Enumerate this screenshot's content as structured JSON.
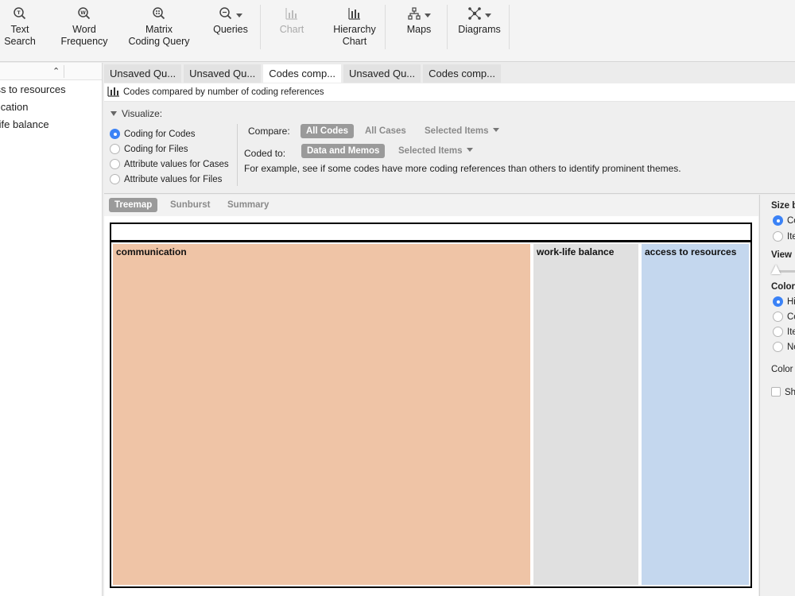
{
  "toolbar": {
    "items": [
      {
        "label": "Text\nSearch",
        "icon": "text-search-icon",
        "enabled": true
      },
      {
        "label": "Word\nFrequency",
        "icon": "word-frequency-icon",
        "enabled": true
      },
      {
        "label": "Matrix\nCoding Query",
        "icon": "matrix-coding-icon",
        "enabled": true
      },
      {
        "label": "Queries",
        "icon": "queries-icon",
        "enabled": true
      },
      {
        "label": "Chart",
        "icon": "chart-icon",
        "enabled": false
      },
      {
        "label": "Hierarchy\nChart",
        "icon": "hierarchy-chart-icon",
        "enabled": true
      },
      {
        "label": "Maps",
        "icon": "maps-icon",
        "enabled": true
      },
      {
        "label": "Diagrams",
        "icon": "diagrams-icon",
        "enabled": true
      }
    ]
  },
  "left_panel": {
    "items": [
      "access to resources",
      "communication",
      "work-life balance"
    ]
  },
  "tabs": [
    {
      "label": "Unsaved Qu...",
      "active": false
    },
    {
      "label": "Unsaved Qu...",
      "active": false
    },
    {
      "label": "Codes comp...",
      "active": true
    },
    {
      "label": "Unsaved Qu...",
      "active": false
    },
    {
      "label": "Codes comp...",
      "active": false
    }
  ],
  "query": {
    "title": "Codes compared by number of coding references"
  },
  "visualize": {
    "title": "Visualize:",
    "options": [
      {
        "label": "Coding for Codes",
        "selected": true
      },
      {
        "label": "Coding for Files",
        "selected": false
      },
      {
        "label": "Attribute values for Cases",
        "selected": false
      },
      {
        "label": "Attribute values for Files",
        "selected": false
      }
    ],
    "compare_label": "Compare:",
    "compare_selected": "All Codes",
    "compare_other": "All Cases",
    "compare_dropdown": "Selected Items",
    "coded_to_label": "Coded to:",
    "coded_to_selected": "Data and Memos",
    "coded_to_dropdown": "Selected Items",
    "example": "For example, see if some codes have more coding references than others to identify prominent themes."
  },
  "view_tabs": [
    {
      "label": "Treemap",
      "active": true
    },
    {
      "label": "Sunburst",
      "active": false
    },
    {
      "label": "Summary",
      "active": false
    }
  ],
  "treemap": {
    "cells": [
      {
        "label": "communication",
        "color": "#efc4a6",
        "share": 0.6635
      },
      {
        "label": "work-life balance",
        "color": "#e0e0e0",
        "share": 0.1665
      },
      {
        "label": "access to resources",
        "color": "#c4d7ee",
        "share": 0.17
      }
    ]
  },
  "right_panel": {
    "size_by": "Size by",
    "size_options": [
      {
        "label": "Coding references",
        "selected": true
      },
      {
        "label": "Items coded",
        "selected": false
      }
    ],
    "view": "View",
    "color_by": "Color",
    "color_options": [
      {
        "label": "Hierarchy",
        "selected": true
      },
      {
        "label": "Coding",
        "selected": false
      },
      {
        "label": "Items",
        "selected": false
      },
      {
        "label": "None",
        "selected": false
      }
    ],
    "color_label": "Color",
    "show_label": "Show"
  },
  "colors": {
    "accent": "#3b82f6",
    "chip": "#9a9a9a"
  }
}
